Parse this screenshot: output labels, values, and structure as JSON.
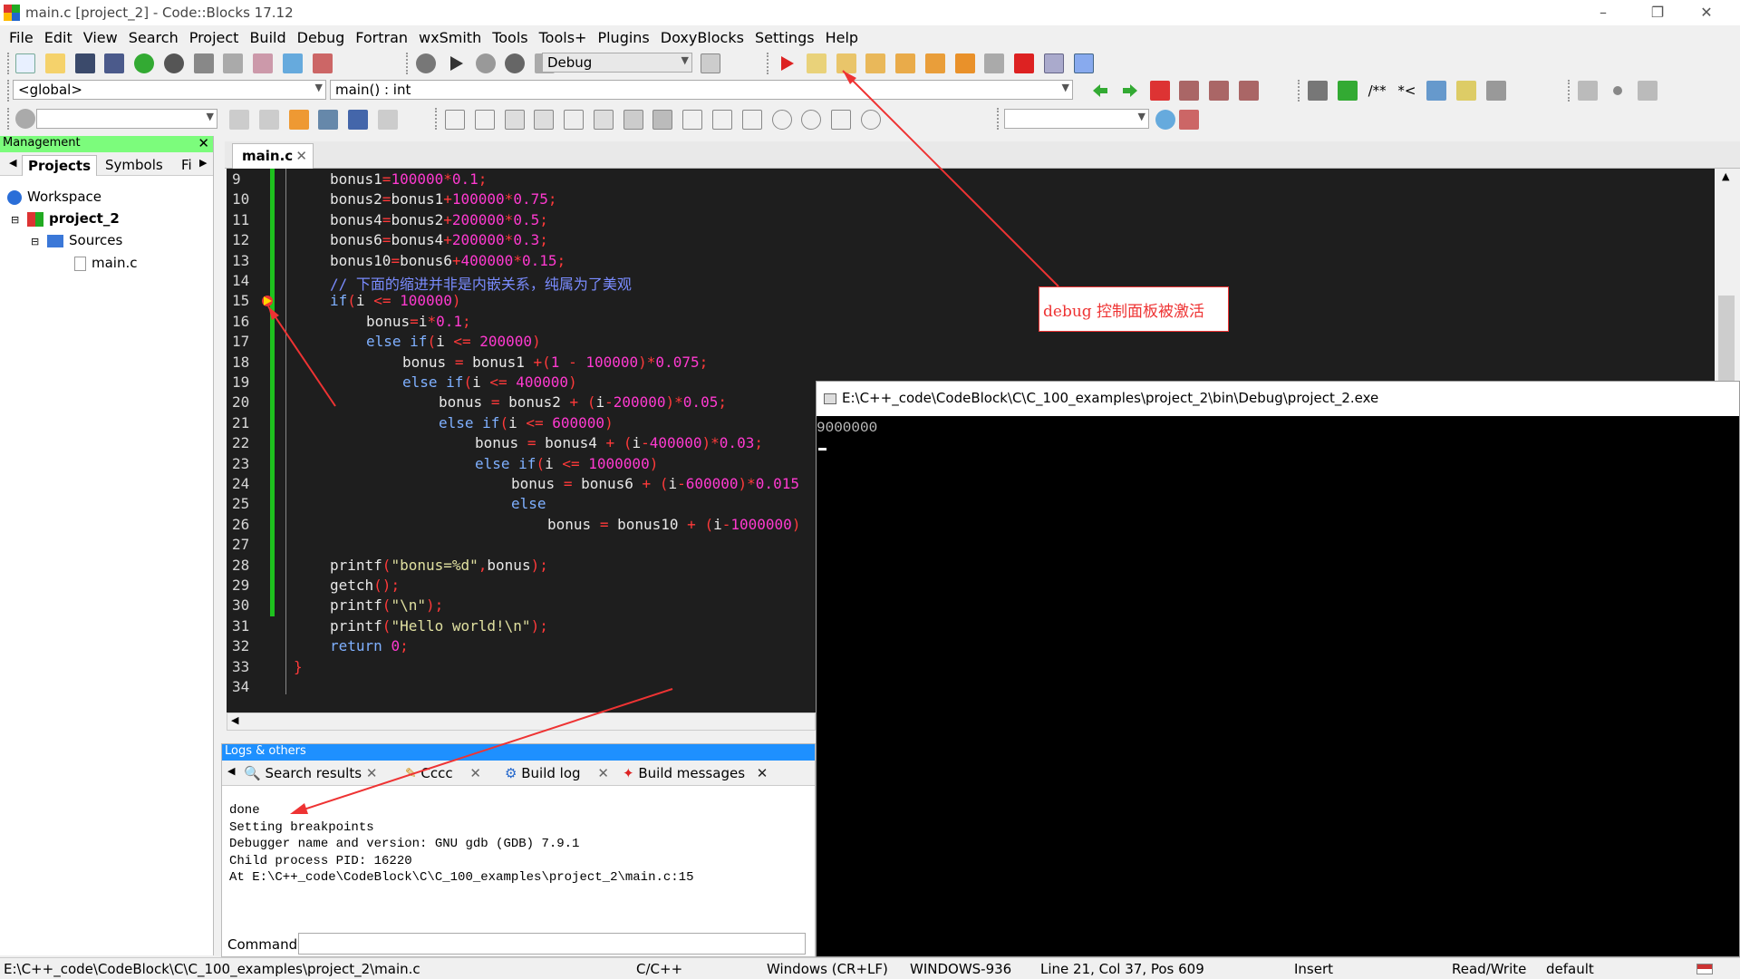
{
  "window": {
    "title": "main.c [project_2] - Code::Blocks 17.12",
    "controls": [
      "–",
      "❐",
      "✕"
    ]
  },
  "menu": [
    "File",
    "Edit",
    "View",
    "Search",
    "Project",
    "Build",
    "Debug",
    "Fortran",
    "wxSmith",
    "Tools",
    "Tools+",
    "Plugins",
    "DoxyBlocks",
    "Settings",
    "Help"
  ],
  "toolbar": {
    "build_target": "Debug",
    "scope": "<global>",
    "function": "main() : int",
    "doxy_comment_1": "/**",
    "doxy_comment_2": "*<"
  },
  "management": {
    "title": "Management",
    "tabs": [
      "Projects",
      "Symbols",
      "Fi"
    ],
    "tree": {
      "workspace": "Workspace",
      "project": "project_2",
      "folder": "Sources",
      "file": "main.c"
    }
  },
  "editor": {
    "tab": "main.c",
    "lines": [
      {
        "n": "9",
        "indent": 0
      },
      {
        "n": "10",
        "indent": 0
      },
      {
        "n": "11",
        "indent": 0
      },
      {
        "n": "12",
        "indent": 0
      },
      {
        "n": "13",
        "indent": 0
      },
      {
        "n": "14",
        "indent": 0
      },
      {
        "n": "15",
        "indent": 0
      },
      {
        "n": "16",
        "indent": 1
      },
      {
        "n": "17",
        "indent": 1
      },
      {
        "n": "18",
        "indent": 2
      },
      {
        "n": "19",
        "indent": 2
      },
      {
        "n": "20",
        "indent": 3
      },
      {
        "n": "21",
        "indent": 3
      },
      {
        "n": "22",
        "indent": 4
      },
      {
        "n": "23",
        "indent": 4
      },
      {
        "n": "24",
        "indent": 5
      },
      {
        "n": "25",
        "indent": 5
      },
      {
        "n": "26",
        "indent": 6
      },
      {
        "n": "27",
        "indent": 0
      },
      {
        "n": "28",
        "indent": 0
      },
      {
        "n": "29",
        "indent": 0
      },
      {
        "n": "30",
        "indent": 0
      },
      {
        "n": "31",
        "indent": 0
      },
      {
        "n": "32",
        "indent": 0
      },
      {
        "n": "33",
        "indent": 0
      },
      {
        "n": "34",
        "indent": 0
      }
    ],
    "code": {
      "l9": "bonus1=100000*0.1;",
      "l10": "bonus2=bonus1+100000*0.75;",
      "l11": "bonus4=bonus2+200000*0.5;",
      "l12": "bonus6=bonus4+200000*0.3;",
      "l13": "bonus10=bonus6+400000*0.15;",
      "l14": "// 下面的缩进并非是内嵌关系，纯属为了美观",
      "l15": "if(i <= 100000)",
      "l16": "bonus=i*0.1;",
      "l17": "else if(i <= 200000)",
      "l18": "bonus = bonus1 +(1 - 100000)*0.075;",
      "l19": "else if(i <= 400000)",
      "l20": "bonus = bonus2 + (i-200000)*0.05;",
      "l21": "else if(i <= 600000)",
      "l22": "bonus = bonus4 + (i-400000)*0.03;",
      "l23": "else if(i <= 1000000)",
      "l24": "bonus = bonus6 + (i-600000)*0.015",
      "l25": "else",
      "l26": "bonus = bonus10 + (i-1000000)",
      "l27": "",
      "l28": "printf(\"bonus=%d\",bonus);",
      "l29": "getch();",
      "l30": "printf(\"\\n\");",
      "l31": "printf(\"Hello world!\\n\");",
      "l32": "return 0;",
      "l33": "}",
      "l34": ""
    }
  },
  "logs": {
    "title": "Logs & others",
    "tabs": [
      "Search results",
      "Cccc",
      "Build log",
      "Build messages"
    ],
    "output": "done\nSetting breakpoints\nDebugger name and version: GNU gdb (GDB) 7.9.1\nChild process PID: 16220\nAt E:\\C++_code\\CodeBlock\\C\\C_100_examples\\project_2\\main.c:15",
    "command_label": "Command:"
  },
  "console": {
    "title": "E:\\C++_code\\CodeBlock\\C\\C_100_examples\\project_2\\bin\\Debug\\project_2.exe",
    "output": "9000000"
  },
  "annotation": {
    "text": "debug 控制面板被激活",
    "color": "#e33333"
  },
  "status": {
    "path": "E:\\C++_code\\CodeBlock\\C\\C_100_examples\\project_2\\main.c",
    "language": "C/C++",
    "eol": "Windows (CR+LF)",
    "encoding": "WINDOWS-936",
    "position": "Line 21, Col 37, Pos 609",
    "mode": "Insert",
    "access": "Read/Write",
    "profile": "default"
  }
}
